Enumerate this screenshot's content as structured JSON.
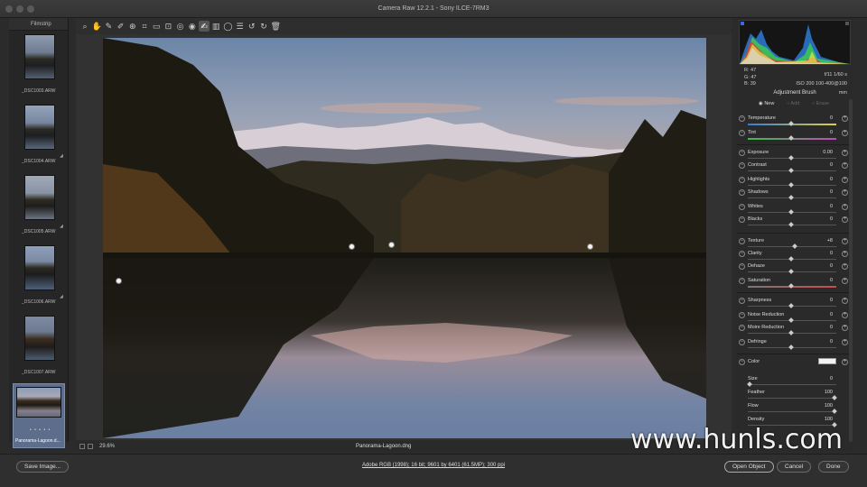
{
  "window": {
    "title": "Camera Raw 12.2.1  -  Sony ILCE-7RM3"
  },
  "filmstrip": {
    "title": "Filmstrip",
    "items": [
      {
        "name": "_DSC1003.ARW"
      },
      {
        "name": "_DSC1004.ARW"
      },
      {
        "name": "_DSC1005.ARW"
      },
      {
        "name": "_DSC1006.ARW"
      },
      {
        "name": "_DSC1007.ARW"
      },
      {
        "name": "Panorama-Lagoon.d...",
        "selected": true,
        "rating": "• • • • •"
      }
    ]
  },
  "toolbar": {
    "tools": [
      "zoom-tool",
      "hand-tool",
      "white-balance-tool",
      "color-sampler-tool",
      "targeted-adjustment-tool",
      "crop-tool",
      "straighten-tool",
      "transform-tool",
      "spot-removal-tool",
      "red-eye-tool",
      "adjustment-brush-tool",
      "graduated-filter-tool",
      "radial-filter-tool",
      "preferences-tool",
      "rotate-left-tool",
      "rotate-right-tool",
      "delete-tool"
    ],
    "active_tool": "adjustment-brush-tool"
  },
  "image": {
    "filename": "Panorama-Lagoon.dng",
    "zoom": "29.6%"
  },
  "readout": {
    "r": "R:   47",
    "g": "G:   47",
    "b": "B:   39",
    "aperture_shutter": "f/11    1/60 s",
    "iso_lens": "ISO 200    100-400@100 mm"
  },
  "adjustment_brush": {
    "title": "Adjustment Brush",
    "modes": [
      "New",
      "Add",
      "Erase"
    ],
    "sliders": [
      {
        "label": "Temperature",
        "value": "0",
        "pos": 0.5
      },
      {
        "label": "Tint",
        "value": "0",
        "pos": 0.5
      },
      {
        "label": "Exposure",
        "value": "0.00",
        "pos": 0.5
      },
      {
        "label": "Contrast",
        "value": "0",
        "pos": 0.5
      },
      {
        "label": "Highlights",
        "value": "0",
        "pos": 0.5
      },
      {
        "label": "Shadows",
        "value": "0",
        "pos": 0.5
      },
      {
        "label": "Whites",
        "value": "0",
        "pos": 0.5
      },
      {
        "label": "Blacks",
        "value": "0",
        "pos": 0.5
      },
      {
        "label": "Texture",
        "value": "+8",
        "pos": 0.54
      },
      {
        "label": "Clarity",
        "value": "0",
        "pos": 0.5
      },
      {
        "label": "Dehaze",
        "value": "0",
        "pos": 0.5
      },
      {
        "label": "Saturation",
        "value": "0",
        "pos": 0.5
      },
      {
        "label": "Sharpness",
        "value": "0",
        "pos": 0.5
      },
      {
        "label": "Noise Reduction",
        "value": "0",
        "pos": 0.5
      },
      {
        "label": "Moire Reduction",
        "value": "0",
        "pos": 0.5
      },
      {
        "label": "Defringe",
        "value": "0",
        "pos": 0.5
      }
    ],
    "color_label": "Color",
    "brush": [
      {
        "label": "Size",
        "value": "0",
        "pos": 0.02
      },
      {
        "label": "Feather",
        "value": "100",
        "pos": 1.0
      },
      {
        "label": "Flow",
        "value": "100",
        "pos": 1.0
      },
      {
        "label": "Density",
        "value": "100",
        "pos": 1.0
      }
    ]
  },
  "bottom": {
    "save_label": "Save Image...",
    "workflow": "Adobe RGB (1998); 16 bit; 9601 by 6401 (61.5MP); 300 ppi",
    "open_label": "Open Object",
    "cancel_label": "Cancel",
    "done_label": "Done"
  },
  "watermark": "www.hunls.com"
}
